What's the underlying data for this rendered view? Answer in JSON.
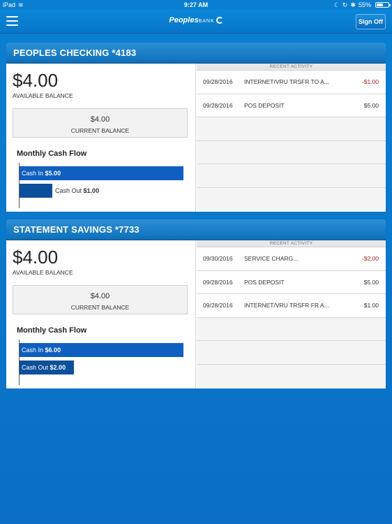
{
  "status_bar": {
    "device": "iPad",
    "time": "9:27 AM",
    "battery": "55%",
    "battery_level": 0.55
  },
  "header": {
    "logo_brand": "Peoples",
    "logo_bank": "BANK",
    "sign_off_label": "Sign Off"
  },
  "accounts": [
    {
      "title": "PEOPLES CHECKING *4183",
      "available_balance": "$4.00",
      "available_label": "AVAILABLE BALANCE",
      "current_balance": "$4.00",
      "current_label": "CURRENT BALANCE",
      "cash_flow_title": "Monthly Cash Flow",
      "cash_in_label": "Cash In",
      "cash_in_amount": "$5.00",
      "cash_in_value": 5.0,
      "cash_out_label": "Cash Out",
      "cash_out_amount": "$1.00",
      "cash_out_value": 1.0,
      "recent_activity_label": "RECENT ACTIVITY",
      "activity": [
        {
          "date": "09/28/2016",
          "description": "INTERNET/VRU TRSFR TO A...",
          "amount": "-$1.00",
          "negative": true
        },
        {
          "date": "09/28/2016",
          "description": "POS DEPOSIT",
          "amount": "$5.00",
          "negative": false
        }
      ]
    },
    {
      "title": "STATEMENT SAVINGS *7733",
      "available_balance": "$4.00",
      "available_label": "AVAILABLE BALANCE",
      "current_balance": "$4.00",
      "current_label": "CURRENT BALANCE",
      "cash_flow_title": "Monthly Cash Flow",
      "cash_in_label": "Cash In",
      "cash_in_amount": "$6.00",
      "cash_in_value": 6.0,
      "cash_out_label": "Cash Out",
      "cash_out_amount": "$2.00",
      "cash_out_value": 2.0,
      "recent_activity_label": "RECENT ACTIVITY",
      "activity": [
        {
          "date": "09/30/2016",
          "description": "SERVICE CHARG...",
          "amount": "-$2.00",
          "negative": true
        },
        {
          "date": "09/28/2016",
          "description": "POS DEPOSIT",
          "amount": "$5.00",
          "negative": false
        },
        {
          "date": "09/28/2016",
          "description": "INTERNET/VRU TRSFR FR A...",
          "amount": "$1.00",
          "negative": false
        }
      ]
    }
  ],
  "colors": {
    "brand_blue": "#0a7fd2",
    "negative_red": "#b5221f",
    "bar_blue": "#0f5fc0"
  }
}
